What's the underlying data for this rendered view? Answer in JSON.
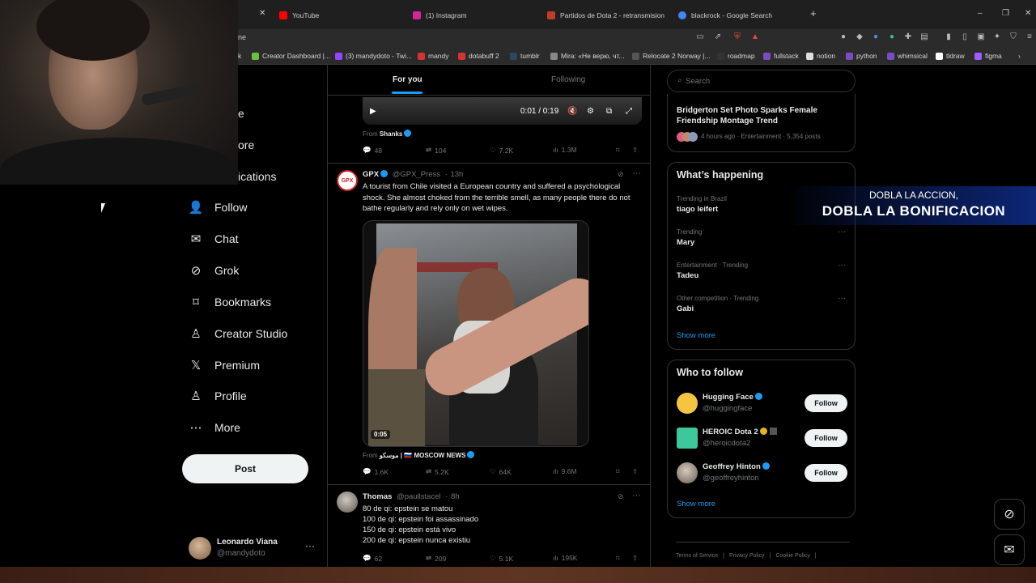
{
  "browser": {
    "tabs": [
      {
        "label": "YouTube",
        "fav": "#ff0000"
      },
      {
        "label": "(1) Instagram",
        "fav": "#d6249f"
      },
      {
        "label": "Partidos de Dota 2 - retransmisiones",
        "fav": "#c23c2a"
      },
      {
        "label": "blackrock - Google Search",
        "fav": "#4285f4"
      }
    ],
    "url_fragment": "ne",
    "bookmarks": [
      {
        "label": "Creator Dashboard |...",
        "fav": "#6dbf3f"
      },
      {
        "label": "(3) mandydoto - Twi...",
        "fav": "#9146ff"
      },
      {
        "label": "mandy",
        "fav": "#d43333"
      },
      {
        "label": "dotabuff 2",
        "fav": "#d43333"
      },
      {
        "label": "tumblr",
        "fav": "#2c4762"
      },
      {
        "label": "Mira: «Не верю, чт...",
        "fav": "#888888"
      },
      {
        "label": "Relocate 2 Norway |...",
        "fav": "#555555"
      },
      {
        "label": "roadmap",
        "fav": "#333333"
      },
      {
        "label": "fullstack",
        "fav": "#7a4cc2"
      },
      {
        "label": "notion",
        "fav": "#dddddd"
      },
      {
        "label": "python",
        "fav": "#7a4cc2"
      },
      {
        "label": "whimsical",
        "fav": "#7a4cc2"
      },
      {
        "label": "tldraw",
        "fav": "#ffffff"
      },
      {
        "label": "figma",
        "fav": "#a259ff"
      }
    ]
  },
  "nav": {
    "fragments": [
      "e",
      "ore",
      "ications"
    ],
    "items": [
      {
        "label": "Follow",
        "icon": "follow-icon",
        "glyph": "👤"
      },
      {
        "label": "Chat",
        "icon": "chat-icon",
        "glyph": "✉"
      },
      {
        "label": "Grok",
        "icon": "grok-icon",
        "glyph": "⊘"
      },
      {
        "label": "Bookmarks",
        "icon": "bookmark-icon",
        "glyph": "🔖"
      },
      {
        "label": "Creator Studio",
        "icon": "creator-studio-icon",
        "glyph": "♙"
      },
      {
        "label": "Premium",
        "icon": "x-logo-icon",
        "glyph": "𝕏"
      },
      {
        "label": "Profile",
        "icon": "profile-icon",
        "glyph": "♙"
      },
      {
        "label": "More",
        "icon": "more-icon",
        "glyph": "⋯"
      }
    ],
    "post_label": "Post",
    "account": {
      "name": "Leonardo Viana",
      "handle": "@mandydoto"
    }
  },
  "feed": {
    "tabs": {
      "for_you": "For you",
      "following": "Following"
    },
    "video_top": {
      "time": "0:01 / 0:19",
      "from_label": "From",
      "from_name": "Shanks",
      "replies": "48",
      "reposts": "104",
      "likes": "7.2K",
      "views": "1.3M"
    },
    "tweet1": {
      "name": "GPX",
      "handle": "@GPX_Press",
      "time": "13h",
      "avatar_text": "GPX",
      "text": "A tourist from Chile visited a European country and suffered a psychological shock. She almost choked from the terrible smell, as many people there do not bathe regularly and rely only on wet wipes.",
      "duration": "0:05",
      "from_label": "From",
      "from_name": "موسكو | 🇷🇺 MOSCOW NEWS",
      "replies": "1.6K",
      "reposts": "5.2K",
      "likes": "64K",
      "views": "9.6M"
    },
    "tweet2": {
      "name": "Thomas",
      "handle": "@paullstacel",
      "time": "8h",
      "lines": [
        "80 de qi: epstein se matou",
        "100 de qi: epstein foi assassinado",
        "150 de qi: epstein está vivo",
        "200 de qi: epstein nunca existiu"
      ],
      "replies": "62",
      "reposts": "209",
      "likes": "5.1K",
      "views": "195K"
    }
  },
  "sidebar": {
    "search_placeholder": "Search",
    "news": {
      "title": "Bridgerton Set Photo Sparks Female Friendship Montage Trend",
      "meta": "4 hours ago · Entertainment · 5,354 posts"
    },
    "happening_title": "What’s happening",
    "trends": [
      {
        "context": "Trending in Brazil",
        "name": "tiago leifert"
      },
      {
        "context": "Trending",
        "name": "Mary"
      },
      {
        "context": "Entertainment · Trending",
        "name": "Tadeu"
      },
      {
        "context": "Other competition · Trending",
        "name": "Gabi"
      }
    ],
    "show_more": "Show more",
    "who_title": "Who to follow",
    "who": [
      {
        "name": "Hugging Face",
        "handle": "@huggingface",
        "badge": "blue",
        "avatar": "#f5c542"
      },
      {
        "name": "HEROIC Dota 2",
        "handle": "@heroicdota2",
        "badge": "gold",
        "avatar": "#3ec79a"
      },
      {
        "name": "Geoffrey Hinton",
        "handle": "@geoffreyhinton",
        "badge": "blue",
        "avatar": "#9a8a7c"
      }
    ],
    "follow_label": "Follow",
    "footer": [
      "Terms of Service",
      "|",
      "Privacy Policy",
      "|",
      "Cookie Policy",
      "|"
    ]
  },
  "promo": {
    "line1": "DOBLA LA ACCION,",
    "line2": "DOBLA LA BONIFICACION"
  }
}
